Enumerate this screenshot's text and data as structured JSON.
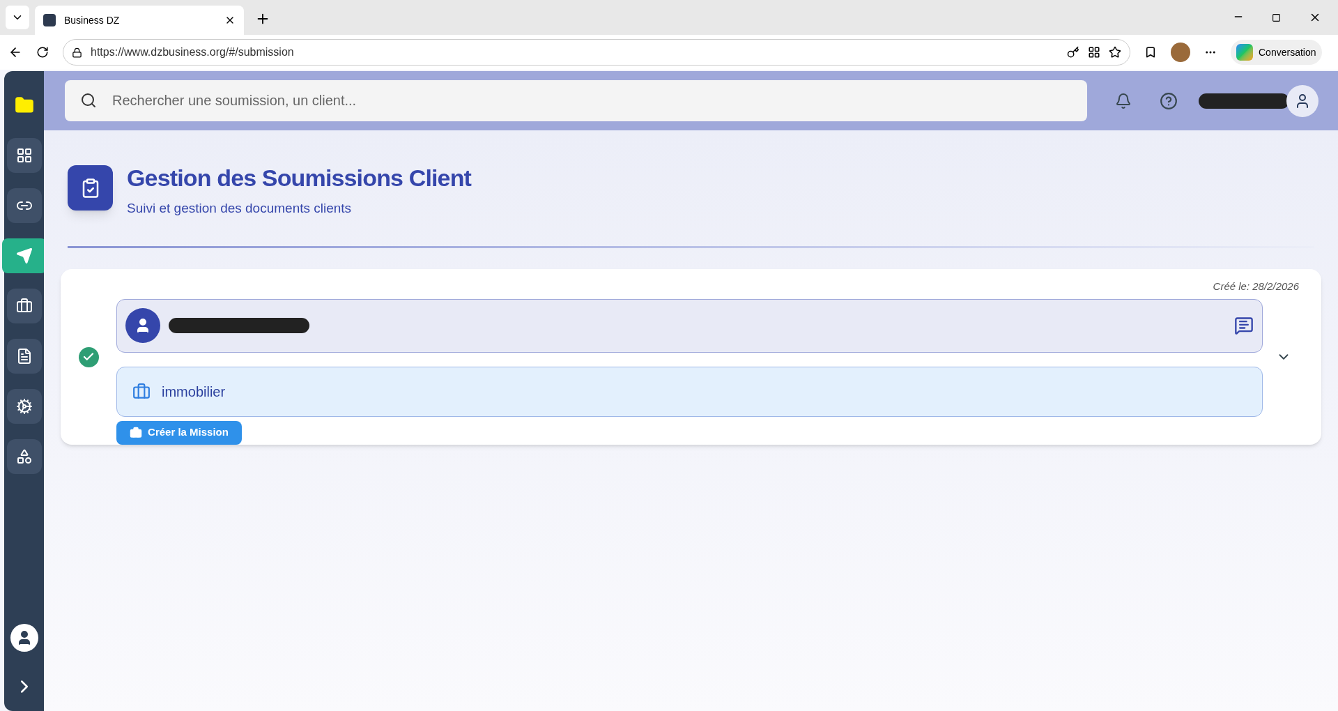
{
  "browser": {
    "tab_title": "Business DZ",
    "url": "https://www.dzbusiness.org/#/submission",
    "copilot_label": "Conversation"
  },
  "sidebar": {
    "items": [
      {
        "selected": false
      },
      {
        "selected": false
      },
      {
        "selected": true
      },
      {
        "selected": false
      },
      {
        "selected": false
      },
      {
        "selected": false
      },
      {
        "selected": false
      }
    ]
  },
  "search": {
    "placeholder": "Rechercher une soumission, un client..."
  },
  "page": {
    "title": "Gestion des Soumissions Client",
    "subtitle": "Suivi et gestion des documents clients"
  },
  "submission": {
    "created": "Créé le: 28/2/2026",
    "done": true,
    "service": "immobilier",
    "action": "Créer la Mission"
  }
}
